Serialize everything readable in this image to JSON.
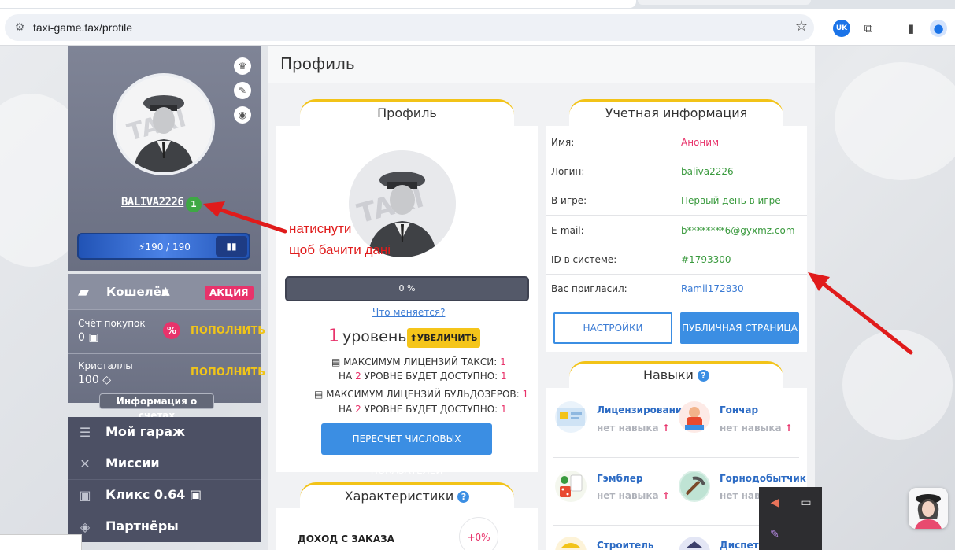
{
  "browser": {
    "url": "taxi-game.tax/profile",
    "translate_badge": "UK"
  },
  "sidebar": {
    "username": "BALIVA2226",
    "level": "1",
    "energy": "190 / 190",
    "wallet": {
      "title": "Кошелёк",
      "promo": "АКЦИЯ",
      "purchases_label": "Счёт покупок",
      "purchases_value": "0",
      "topup1": "ПОПОЛНИТЬ",
      "pct": "%",
      "crystals_label": "Кристаллы",
      "crystals_value": "100",
      "topup2": "ПОПОЛНИТЬ",
      "accounts_info": "Информация о счетах"
    },
    "menu": [
      {
        "label": "Мой гараж"
      },
      {
        "label": "Миссии"
      },
      {
        "label": "Кликс 0.64"
      },
      {
        "label": "Партнёры"
      }
    ]
  },
  "main": {
    "page_title": "Профиль",
    "profile_card": {
      "tab": "Профиль",
      "progress": "0 %",
      "progress_value": 0,
      "what_changes": "Что меняется?",
      "level_num": "1",
      "level_word": "уровень",
      "increase": "УВЕЛИЧИТЬ",
      "lic_taxi_1": "МАКСИМУМ ЛИЦЕНЗИЙ ТАКСИ:",
      "lic_taxi_1_val": "1",
      "lic_taxi_2a": "НА",
      "lic_taxi_2_lvl": "2",
      "lic_taxi_2b": "УРОВНЕ БУДЕТ ДОСТУПНО:",
      "lic_taxi_2_val": "1",
      "lic_bull_1": "МАКСИМУМ ЛИЦЕНЗИЙ БУЛЬДОЗЕРОВ:",
      "lic_bull_1_val": "1",
      "lic_bull_2a": "НА",
      "lic_bull_2_lvl": "2",
      "lic_bull_2b": "УРОВНЕ БУДЕТ ДОСТУПНО:",
      "lic_bull_2_val": "1",
      "recalc": "ПЕРЕСЧЕТ ЧИСЛОВЫХ ПОКАЗАТЕЛЕЙ"
    },
    "account_card": {
      "tab": "Учетная информация",
      "rows": [
        {
          "k": "Имя:",
          "v": "Аноним"
        },
        {
          "k": "Логин:",
          "v": "baliva2226"
        },
        {
          "k": "В игре:",
          "v": "Первый день в игре"
        },
        {
          "k": "E-mail:",
          "v": "b********6@gyxmz.com"
        },
        {
          "k": "ID в системе:",
          "v": "#1793300"
        },
        {
          "k": "Вас пригласил:",
          "v": "Ramil172830"
        }
      ],
      "settings": "НАСТРОЙКИ",
      "public_page": "ПУБЛИЧНАЯ СТРАНИЦА"
    },
    "skills_card": {
      "tab": "Навыки",
      "help": "?",
      "skills": [
        {
          "name": "Лицензирование",
          "status": "нет навыка"
        },
        {
          "name": "Гончар",
          "status": "нет навыка"
        },
        {
          "name": "Гэмблер",
          "status": "нет навыка"
        },
        {
          "name": "Горнодобытчик",
          "status": "нет навыка"
        },
        {
          "name": "Строитель",
          "status": ""
        },
        {
          "name": "Диспет",
          "status": ""
        }
      ]
    },
    "chars_card": {
      "tab": "Характеристики",
      "help": "?",
      "income_label": "ДОХОД С ЗАКАЗА",
      "income_value": "+0%"
    }
  },
  "annotation": {
    "line1": "натиснути",
    "line2": "щоб бачити дані",
    "color": "#e01b1b"
  }
}
